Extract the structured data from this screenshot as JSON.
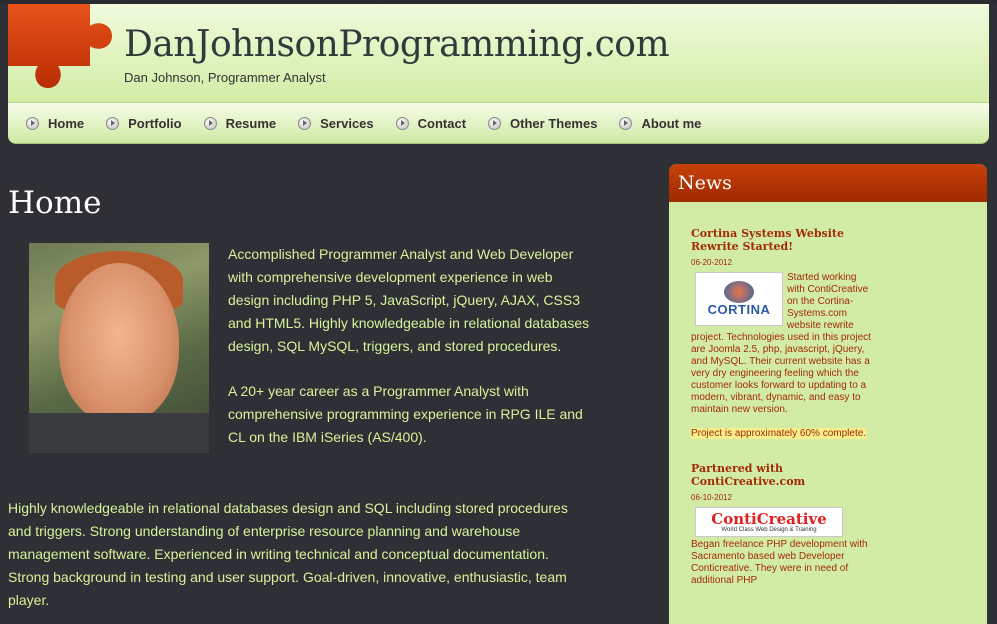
{
  "header": {
    "title": "DanJohnsonProgramming.com",
    "subtitle": "Dan Johnson, Programmer Analyst",
    "colors": {
      "accent": "#c9470d",
      "header_bg": "#e4f5c4"
    }
  },
  "nav": {
    "items": [
      {
        "label": "Home"
      },
      {
        "label": "Portfolio"
      },
      {
        "label": "Resume"
      },
      {
        "label": "Services"
      },
      {
        "label": "Contact"
      },
      {
        "label": "Other Themes"
      },
      {
        "label": "About me"
      }
    ]
  },
  "main": {
    "title": "Home",
    "intro_p1": "Accomplished Programmer Analyst and Web Developer with comprehensive development experience in web design including PHP 5, JavaScript, jQuery, AJAX, CSS3 and HTML5. Highly knowledgeable in relational databases design, SQL MySQL, triggers, and stored procedures.",
    "intro_p2": "A 20+ year career as a Programmer Analyst with comprehensive programming experience in RPG ILE and CL on the IBM iSeries (AS/400).",
    "intro_p3": "Highly knowledgeable in relational databases design and SQL including stored procedures and triggers. Strong understanding of enterprise resource planning and warehouse management software. Experienced in writing technical and conceptual documentation. Strong background in testing and user support. Goal-driven, innovative, enthusiastic, team player."
  },
  "sidebar": {
    "title": "News",
    "items": [
      {
        "title": "Cortina Systems Website Rewrite Started!",
        "date": "06-20-2012",
        "logo_text": "CORTINA",
        "body": "Started working with ContiCreative on the Cortina-Systems.com website rewrite project.  Technologies used in this project are Joomla 2.5, php, javascript, jQuery, and MySQL.  Their current website has a very dry engineering feeling which the customer looks forward to updating to a modern, vibrant, dynamic, and easy to maintain new version.",
        "highlight": "Project is approximately 60% complete."
      },
      {
        "title": "Partnered with ContiCreative.com",
        "date": "06-10-2012",
        "logo_text": "ContiCreative",
        "logo_sub": "World Class Web Design & Training",
        "body": "Began freelance PHP development with Sacramento based web Developer Conticreative.  They were in need of additional PHP"
      }
    ]
  }
}
